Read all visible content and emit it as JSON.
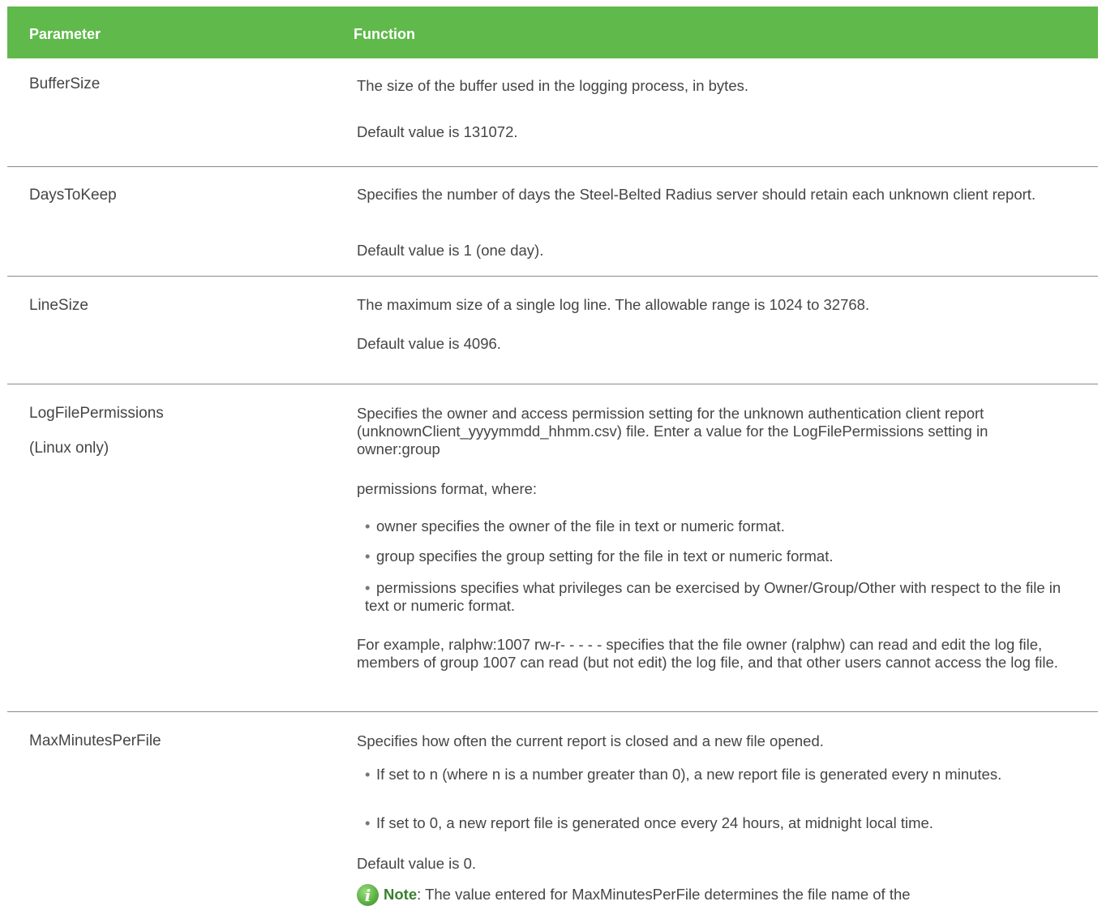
{
  "header": {
    "col1": "Parameter",
    "col2": "Function"
  },
  "rows": [
    {
      "param": "BufferSize",
      "lines": [
        "The size of the buffer used in the logging process, in bytes.",
        "Default value is 131072."
      ]
    },
    {
      "param": "DaysToKeep",
      "lines": [
        "Specifies the number of days the Steel-Belted Radius server should retain each unknown client report.",
        "Default value is 1 (one day)."
      ]
    },
    {
      "param": "LineSize",
      "lines": [
        "The maximum size of a single log line. The allowable range is 1024 to 32768.",
        "Default value is 4096."
      ]
    },
    {
      "param": "LogFilePermissions",
      "param_note": "(Linux only)",
      "lines": [
        "Specifies the owner and access permission setting for the unknown authentication client report (unknownClient_yyyymmdd_hhmm.csv) file. Enter a value for the LogFilePermissions setting in owner:group",
        "permissions format, where:",
        "owner specifies the owner of the file in text or numeric format.",
        "group specifies the group setting for the file in text or numeric format.",
        "permissions specifies what privileges can be exercised by Owner/Group/Other with respect to the file in text or numeric format.",
        "For example, ralphw:1007 rw-r- - - - - specifies that the file owner (ralphw) can read and edit the log file, members of group 1007 can read (but not edit) the log file, and that other users cannot access the log file."
      ]
    },
    {
      "param": "MaxMinutesPerFile",
      "lines": [
        "Specifies how often the current report is closed and a new file opened.",
        "If set to n (where n is a number greater than 0), a new report file is generated every n minutes.",
        "If set to 0, a new report file is generated once every 24 hours, at midnight local time.",
        "Default value is 0."
      ],
      "note_label": "Note",
      "note_text": ": The value entered for MaxMinutesPerFile determines the file name of the"
    }
  ],
  "icons": {
    "note": "info-icon"
  },
  "colors": {
    "header_bg": "#5fb94b",
    "text": "#454545",
    "note_label": "#3a7f2c"
  }
}
